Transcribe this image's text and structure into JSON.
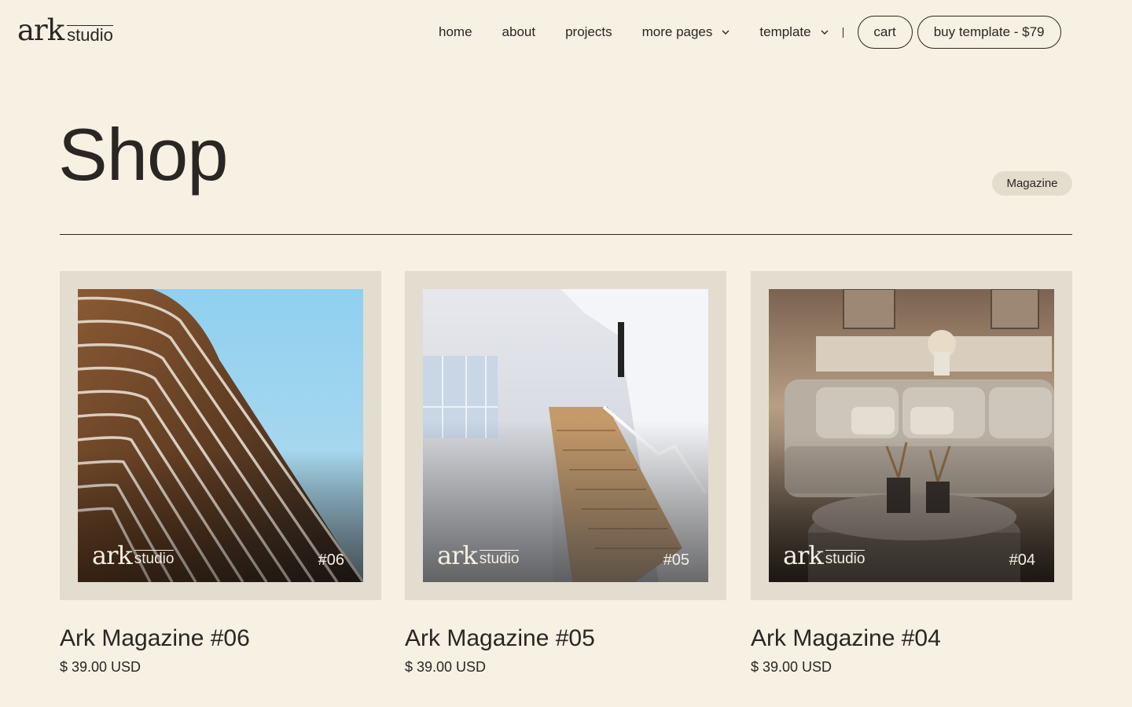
{
  "brand": {
    "ark": "ark",
    "studio": "studio"
  },
  "nav": {
    "home": "home",
    "about": "about",
    "projects": "projects",
    "more_pages": "more pages",
    "template": "template",
    "cart": "cart",
    "buy": "buy template - $79"
  },
  "page": {
    "title": "Shop",
    "tag": "Magazine"
  },
  "products": [
    {
      "title": "Ark Magazine #06",
      "price": "$ 39.00 USD",
      "cover_num": "#06",
      "cover_ark": "ark",
      "cover_studio": "studio"
    },
    {
      "title": "Ark Magazine #05",
      "price": "$ 39.00 USD",
      "cover_num": "#05",
      "cover_ark": "ark",
      "cover_studio": "studio"
    },
    {
      "title": "Ark Magazine #04",
      "price": "$ 39.00 USD",
      "cover_num": "#04",
      "cover_ark": "ark",
      "cover_studio": "studio"
    }
  ],
  "colors": {
    "background": "#f7f1e3",
    "text": "#2a2622",
    "frame": "#e3ddcf",
    "tag_bg": "#e4ddcd"
  },
  "icons": {
    "dropdown": "chevron-down-icon"
  }
}
